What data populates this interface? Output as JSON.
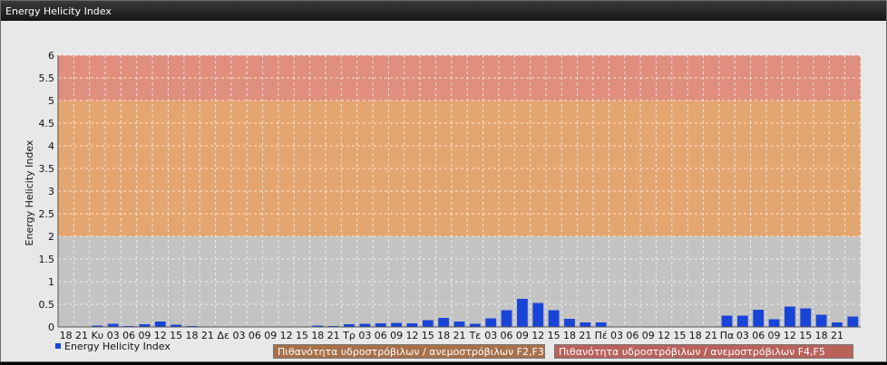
{
  "window": {
    "title": "Energy Helicity Index"
  },
  "legend": {
    "label": "Energy Helicity Index"
  },
  "bands": [
    {
      "label": "Πιθανότητα υδροστρόβιλων / ανεμοστρόβιλων F2,F3",
      "color": "#a8704a"
    },
    {
      "label": "Πιθανότητα υδροστρόβιλων / ανεμοστρόβιλων F4,F5",
      "color": "#b8625a"
    }
  ],
  "colors": {
    "bar": "#1844d8",
    "zone_low": "#c3c3c3",
    "zone_mid": "#e4a670",
    "zone_high": "#e08f7e"
  },
  "chart_data": {
    "type": "bar",
    "title": "",
    "xlabel": "",
    "ylabel": "Energy Helicity Index",
    "ylim": [
      0,
      6
    ],
    "yticks": [
      0,
      0.5,
      1,
      1.5,
      2,
      2.5,
      3,
      3.5,
      4,
      4.5,
      5,
      5.5,
      6
    ],
    "grid": true,
    "legend_position": "bottom-left",
    "zones": [
      {
        "from": 0,
        "to": 2,
        "color": "#c3c3c3"
      },
      {
        "from": 2,
        "to": 5,
        "color": "#e4a670"
      },
      {
        "from": 5,
        "to": 6,
        "color": "#e08f7e"
      }
    ],
    "categories": [
      "18",
      "21",
      "Κυ",
      "03",
      "06",
      "09",
      "12",
      "15",
      "18",
      "21",
      "Δε",
      "03",
      "06",
      "09",
      "12",
      "15",
      "18",
      "21",
      "Τρ",
      "03",
      "06",
      "09",
      "12",
      "15",
      "18",
      "21",
      "Τε",
      "03",
      "06",
      "09",
      "12",
      "15",
      "18",
      "21",
      "Πέ",
      "03",
      "06",
      "09",
      "12",
      "15",
      "18",
      "21",
      "Πα",
      "03",
      "06",
      "09",
      "12",
      "15",
      "18",
      "21"
    ],
    "series": [
      {
        "name": "Energy Helicity Index",
        "values": [
          0.01,
          0.01,
          0.03,
          0.07,
          0.02,
          0.06,
          0.12,
          0.05,
          0.02,
          0.01,
          0.01,
          0.01,
          0.01,
          0.01,
          0.01,
          0.01,
          0.03,
          0.02,
          0.06,
          0.07,
          0.08,
          0.09,
          0.08,
          0.15,
          0.2,
          0.12,
          0.07,
          0.19,
          0.37,
          0.62,
          0.53,
          0.37,
          0.18,
          0.1,
          0.1,
          0.01,
          0.01,
          0.01,
          0.01,
          0.01,
          0.01,
          0.01,
          0.25,
          0.25,
          0.38,
          0.17,
          0.45,
          0.41,
          0.27,
          0.1,
          0.23
        ]
      }
    ]
  }
}
